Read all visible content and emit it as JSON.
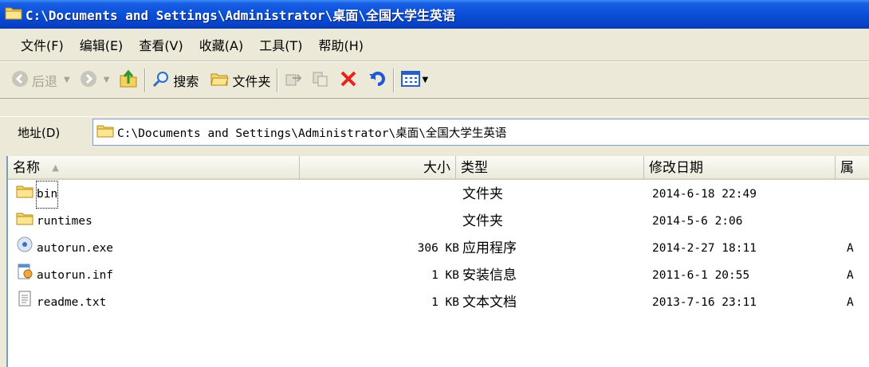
{
  "window": {
    "title": "C:\\Documents and Settings\\Administrator\\桌面\\全国大学生英语",
    "title_icon": "folder-icon"
  },
  "menu": {
    "items": [
      "文件(F)",
      "编辑(E)",
      "查看(V)",
      "收藏(A)",
      "工具(T)",
      "帮助(H)"
    ]
  },
  "toolbar": {
    "back_label": "后退",
    "search_label": "搜索",
    "folders_label": "文件夹"
  },
  "address": {
    "label": "地址(D)",
    "value": "C:\\Documents and Settings\\Administrator\\桌面\\全国大学生英语"
  },
  "columns": {
    "name": "名称",
    "size": "大小",
    "type": "类型",
    "modified": "修改日期",
    "attr": "属"
  },
  "files": [
    {
      "name": "bin",
      "size": "",
      "type": "文件夹",
      "modified": "2014-6-18 22:49",
      "attr": "",
      "icon": "folder-icon"
    },
    {
      "name": "runtimes",
      "size": "",
      "type": "文件夹",
      "modified": "2014-5-6 2:06",
      "attr": "",
      "icon": "folder-icon"
    },
    {
      "name": "autorun.exe",
      "size": "306 KB",
      "type": "应用程序",
      "modified": "2014-2-27 18:11",
      "attr": "A",
      "icon": "disc-icon"
    },
    {
      "name": "autorun.inf",
      "size": "1 KB",
      "type": "安装信息",
      "modified": "2011-6-1 20:55",
      "attr": "A",
      "icon": "setup-info-icon"
    },
    {
      "name": "readme.txt",
      "size": "1 KB",
      "type": "文本文档",
      "modified": "2013-7-16 23:11",
      "attr": "A",
      "icon": "text-document-icon"
    }
  ]
}
